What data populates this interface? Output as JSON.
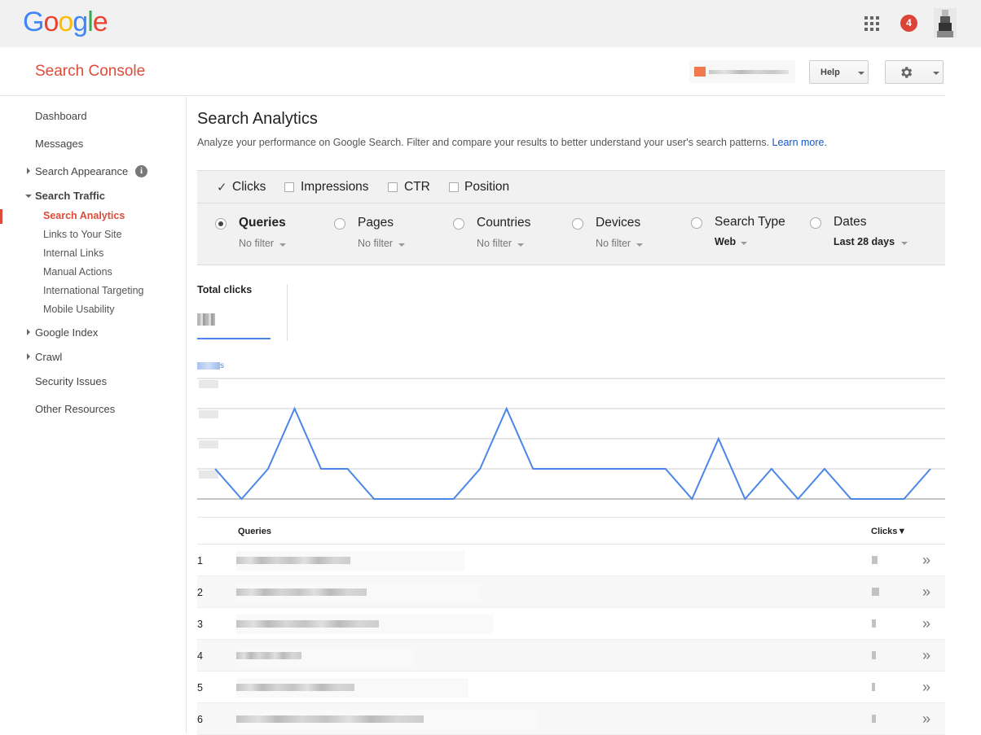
{
  "google": {
    "logo_letters": [
      {
        "ch": "G",
        "color": "#4285f4"
      },
      {
        "ch": "o",
        "color": "#ea4335"
      },
      {
        "ch": "o",
        "color": "#fbbc05"
      },
      {
        "ch": "g",
        "color": "#4285f4"
      },
      {
        "ch": "l",
        "color": "#34a853"
      },
      {
        "ch": "e",
        "color": "#ea4335"
      }
    ],
    "notification_count": "4",
    "icons": [
      "apps-grid-icon",
      "avatar"
    ]
  },
  "header": {
    "title": "Search Console",
    "help_label": "Help",
    "settings_icon": "gear-icon"
  },
  "sidebar": {
    "dashboard": "Dashboard",
    "messages": "Messages",
    "search_appearance": "Search Appearance",
    "search_traffic": "Search Traffic",
    "search_analytics": "Search Analytics",
    "links_to_site": "Links to Your Site",
    "internal_links": "Internal Links",
    "manual_actions": "Manual Actions",
    "international_targeting": "International Targeting",
    "mobile_usability": "Mobile Usability",
    "google_index": "Google Index",
    "crawl": "Crawl",
    "security_issues": "Security Issues",
    "other_resources": "Other Resources",
    "info_glyph": "i"
  },
  "main": {
    "title": "Search Analytics",
    "description": "Analyze your performance on Google Search. Filter and compare your results to better understand your user's search patterns.",
    "learn_more": "Learn more.",
    "metrics": {
      "clicks": "Clicks",
      "impressions": "Impressions",
      "ctr": "CTR",
      "position": "Position",
      "checked": [
        "Clicks"
      ]
    },
    "dimensions": {
      "queries": "Queries",
      "queries_filter": "No filter",
      "pages": "Pages",
      "pages_filter": "No filter",
      "countries": "Countries",
      "countries_filter": "No filter",
      "devices": "Devices",
      "devices_filter": "No filter",
      "search_type": "Search Type",
      "search_type_value": "Web",
      "dates": "Dates",
      "dates_value": "Last 28 days",
      "selected": "Queries"
    },
    "total_clicks_label": "Total clicks",
    "axis_label_suffix": "s",
    "table": {
      "col_queries": "Queries",
      "col_clicks": "Clicks▼",
      "rows": [
        {
          "num": "1"
        },
        {
          "num": "2"
        },
        {
          "num": "3"
        },
        {
          "num": "4"
        },
        {
          "num": "5"
        },
        {
          "num": "6"
        }
      ],
      "action_glyph": "»"
    }
  },
  "chart_data": {
    "type": "line",
    "series": [
      {
        "values": [
          1,
          0,
          1,
          3,
          1,
          1,
          0,
          0,
          0,
          0,
          1,
          3,
          1,
          1,
          1,
          1,
          1,
          1,
          0,
          2,
          0,
          1,
          0,
          1,
          0,
          0,
          0,
          1
        ]
      }
    ],
    "ylim": [
      0,
      4
    ],
    "grid": true,
    "color": "#4a86e8"
  }
}
